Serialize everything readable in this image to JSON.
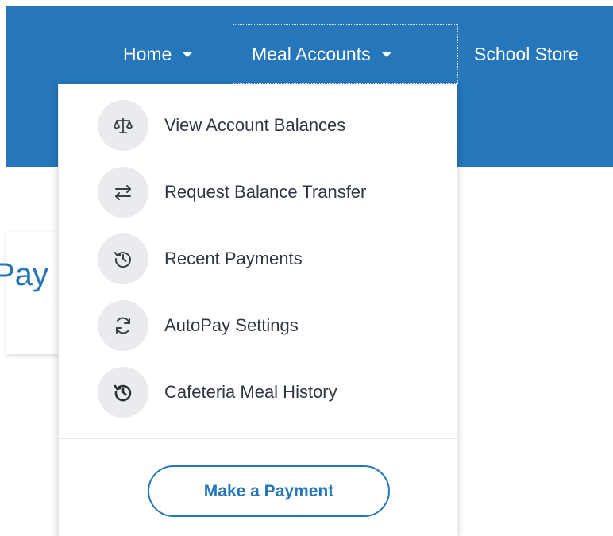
{
  "nav": {
    "items": [
      {
        "label": "Home"
      },
      {
        "label": "Meal Accounts"
      },
      {
        "label": "School Store"
      }
    ]
  },
  "page": {
    "title_fragment": "Pay"
  },
  "dropdown": {
    "items": [
      {
        "label": "View Account Balances",
        "icon": "scale-icon"
      },
      {
        "label": "Request Balance Transfer",
        "icon": "transfer-arrows-icon"
      },
      {
        "label": "Recent Payments",
        "icon": "history-icon"
      },
      {
        "label": "AutoPay Settings",
        "icon": "refresh-icon"
      },
      {
        "label": "Cafeteria Meal History",
        "icon": "history-icon"
      }
    ],
    "action_button": "Make a Payment"
  },
  "colors": {
    "brand_blue": "#2576ba",
    "icon_bg": "#e9ebee",
    "text_dark": "#2f3742"
  }
}
